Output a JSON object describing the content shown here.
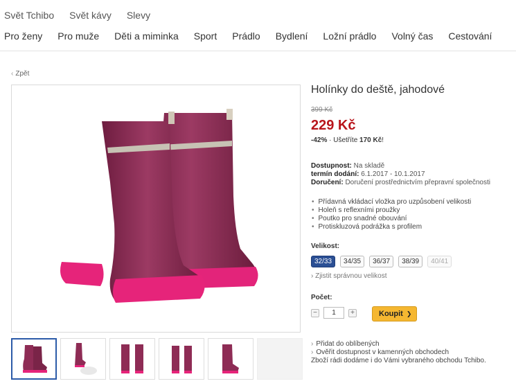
{
  "top_nav": [
    "Svět Tchibo",
    "Svět kávy",
    "Slevy"
  ],
  "main_nav": [
    "Pro ženy",
    "Pro muže",
    "Děti a miminka",
    "Sport",
    "Prádlo",
    "Bydlení",
    "Ložní prádlo",
    "Volný čas",
    "Cestování"
  ],
  "back": {
    "label": "Zpět",
    "icon": "chevron-left-icon"
  },
  "product": {
    "title": "Holínky do deště, jahodové",
    "old_price": "399 Kč",
    "price": "229 Kč",
    "discount": "-42%",
    "saving_label": "Ušetříte",
    "saving_value": "170 Kč",
    "saving_suffix": "!",
    "availability_label": "Dostupnost:",
    "availability_value": "Na skladě",
    "delivery_label": "termín dodání:",
    "delivery_value": "6.1.2017 - 10.1.2017",
    "shipping_label": "Doručení:",
    "shipping_value": "Doručení prostřednictvím přepravní společnosti",
    "features": [
      "Přídavná vkládací vložka pro uzpůsobení velikosti",
      "Holeň s reflexními proužky",
      "Poutko pro snadné obouvání",
      "Protiskluzová podrážka s profilem"
    ],
    "size_label": "Velikost:",
    "sizes": [
      "32/33",
      "34/35",
      "36/37",
      "38/39",
      "40/41"
    ],
    "selected_size": "32/33",
    "size_check": "Zjistit správnou velikost",
    "qty_label": "Počet:",
    "qty_value": "1",
    "minus": "−",
    "plus": "+",
    "buy_label": "Koupit",
    "buy_arrow": "❯",
    "favorite_link": "Přidat do oblíbených",
    "store_link_1": "Ověřit dostupnost v kamenných obchodech",
    "store_link_2": "Zboží rádi dodáme i do Vámi vybraného obchodu Tchibo."
  },
  "colors": {
    "price": "#b8151b",
    "boot": "#8e2c55",
    "sole": "#e6247a",
    "buy": "#f5b731",
    "selected_size": "#2b4f94"
  }
}
